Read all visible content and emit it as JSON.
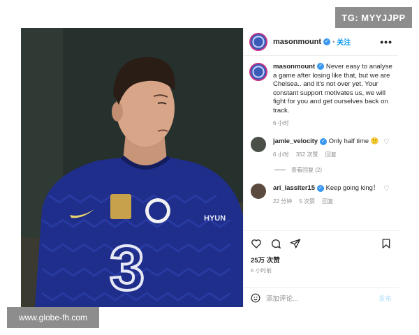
{
  "watermarks": {
    "top_right": "TG: MYYJJPP",
    "bottom_left": "www.globe-fh.com"
  },
  "post": {
    "image_alt": "Chelsea player in blue home kit",
    "kit_sponsor_text": "3",
    "kit_sleeve_text": "HYUN",
    "header": {
      "username": "masonmount",
      "follow_label": "关注",
      "more_label": "•••"
    },
    "caption": {
      "username": "masonmount",
      "text": "Never easy to analyse a game after losing like that, but we are Chelsea.. and it's not over yet. Your constant support motivates us, we will fight for you and get ourselves back on track.",
      "time": "6 小时"
    },
    "comments": [
      {
        "username": "jamie_velocity",
        "text": "Only half time",
        "emoji": "🙂",
        "time": "6 小时",
        "likes": "352 次赞",
        "reply": "回复",
        "avatar_color": "#4a4f47"
      },
      {
        "username": "ari_lassiter15",
        "text": "Keep going king！",
        "time": "22 分钟",
        "likes": "5 次赞",
        "reply": "回复",
        "avatar_color": "#5b4a3f"
      }
    ],
    "view_replies": "查看回复 (2)",
    "likes_count": "25万 次赞",
    "time_ago": "6 小时前",
    "add_comment_placeholder": "添加评论...",
    "post_label": "发布"
  },
  "colors": {
    "accent_blue": "#0095f6",
    "verified": "#3897f0",
    "kit_blue": "#1f2e8a"
  }
}
